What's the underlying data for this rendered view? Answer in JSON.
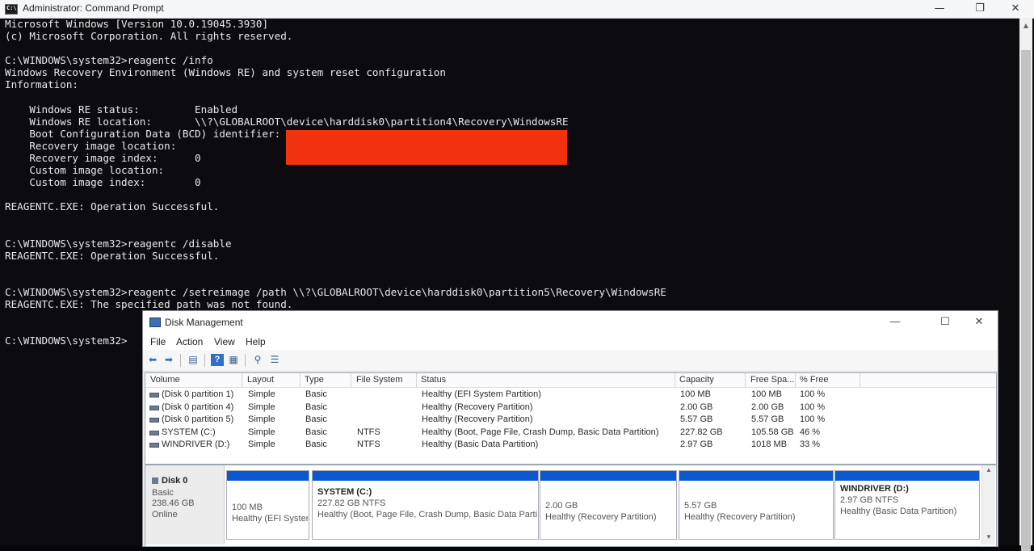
{
  "cmd": {
    "title": "Administrator: Command Prompt",
    "icon_label": "C:\\",
    "window_controls": [
      "—",
      "❐",
      "✕"
    ],
    "lines": [
      "Microsoft Windows [Version 10.0.19045.3930]",
      "(c) Microsoft Corporation. All rights reserved.",
      "",
      "C:\\WINDOWS\\system32>reagentc /info",
      "Windows Recovery Environment (Windows RE) and system reset configuration",
      "Information:",
      "",
      "    Windows RE status:         Enabled",
      "    Windows RE location:       \\\\?\\GLOBALROOT\\device\\harddisk0\\partition4\\Recovery\\WindowsRE",
      "    Boot Configuration Data (BCD) identifier:",
      "    Recovery image location:",
      "    Recovery image index:      0",
      "    Custom image location:",
      "    Custom image index:        0",
      "",
      "REAGENTC.EXE: Operation Successful.",
      "",
      "",
      "C:\\WINDOWS\\system32>reagentc /disable",
      "REAGENTC.EXE: Operation Successful.",
      "",
      "",
      "C:\\WINDOWS\\system32>reagentc /setreimage /path \\\\?\\GLOBALROOT\\device\\harddisk0\\partition5\\Recovery\\WindowsRE",
      "REAGENTC.EXE: The specified path was not found.",
      "",
      "",
      "C:\\WINDOWS\\system32>"
    ],
    "redaction_color": "#f2320e"
  },
  "disk_management": {
    "title": "Disk Management",
    "window_controls": [
      "—",
      "☐",
      "✕"
    ],
    "menu": [
      "File",
      "Action",
      "View",
      "Help"
    ],
    "toolbar_icons": [
      "back-arrow-icon",
      "forward-arrow-icon",
      "console-tree-icon",
      "help-icon",
      "properties-icon",
      "connect-icon",
      "list-view-icon"
    ],
    "columns": [
      "Volume",
      "Layout",
      "Type",
      "File System",
      "Status",
      "Capacity",
      "Free Spa...",
      "% Free"
    ],
    "volumes": [
      {
        "volume": "(Disk 0 partition 1)",
        "layout": "Simple",
        "type": "Basic",
        "fs": "",
        "status": "Healthy (EFI System Partition)",
        "capacity": "100 MB",
        "free": "100 MB",
        "pct": "100 %"
      },
      {
        "volume": "(Disk 0 partition 4)",
        "layout": "Simple",
        "type": "Basic",
        "fs": "",
        "status": "Healthy (Recovery Partition)",
        "capacity": "2.00 GB",
        "free": "2.00 GB",
        "pct": "100 %"
      },
      {
        "volume": "(Disk 0 partition 5)",
        "layout": "Simple",
        "type": "Basic",
        "fs": "",
        "status": "Healthy (Recovery Partition)",
        "capacity": "5.57 GB",
        "free": "5.57 GB",
        "pct": "100 %"
      },
      {
        "volume": "SYSTEM (C:)",
        "layout": "Simple",
        "type": "Basic",
        "fs": "NTFS",
        "status": "Healthy (Boot, Page File, Crash Dump, Basic Data Partition)",
        "capacity": "227.82 GB",
        "free": "105.58 GB",
        "pct": "46 %"
      },
      {
        "volume": "WINDRIVER (D:)",
        "layout": "Simple",
        "type": "Basic",
        "fs": "NTFS",
        "status": "Healthy (Basic Data Partition)",
        "capacity": "2.97 GB",
        "free": "1018 MB",
        "pct": "33 %"
      }
    ],
    "disk": {
      "name": "Disk 0",
      "type": "Basic",
      "size": "238.46 GB",
      "state": "Online"
    },
    "partitions": [
      {
        "name": "",
        "size": "100 MB",
        "status": "Healthy (EFI Syster"
      },
      {
        "name": "SYSTEM  (C:)",
        "size": "227.82 GB NTFS",
        "status": "Healthy (Boot, Page File, Crash Dump, Basic Data Partit"
      },
      {
        "name": "",
        "size": "2.00 GB",
        "status": "Healthy (Recovery Partition)"
      },
      {
        "name": "",
        "size": "5.57 GB",
        "status": "Healthy (Recovery Partition)"
      },
      {
        "name": "WINDRIVER  (D:)",
        "size": "2.97 GB NTFS",
        "status": "Healthy (Basic Data Partition)"
      }
    ],
    "partition_stripe_color": "#0b57cf"
  }
}
